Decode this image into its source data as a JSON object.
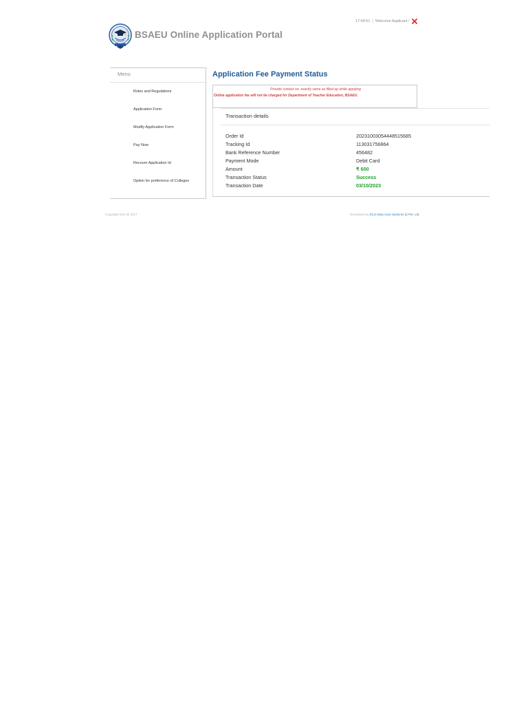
{
  "header": {
    "time": "17:49:51",
    "separator": "|",
    "welcome": "Welcome Applicant !",
    "title": "BSAEU Online Application Portal",
    "close_icon": "close-icon",
    "logo_icon": "university-seal-icon"
  },
  "sidebar": {
    "heading": "Menu",
    "items": [
      {
        "label": "Rules and Regulations"
      },
      {
        "label": "Application Form"
      },
      {
        "label": "Modify Application Form"
      },
      {
        "label": "Pay Now"
      },
      {
        "label": "Recover Application Id"
      },
      {
        "label": "Option for preference of Colleges"
      }
    ]
  },
  "main": {
    "title": "Application Fee Payment Status",
    "notice_1": "Provide contact no. exactly same as filled-up while applying",
    "notice_2": "Online application fee will not be charged for Department of Teacher Education, BSAEU.",
    "transaction_heading": "Transaction details",
    "transaction": [
      {
        "label": "Order Id",
        "value": "20231003054448515685"
      },
      {
        "label": "Tracking Id",
        "value": "113031756864"
      },
      {
        "label": "Bank Reference Number",
        "value": "456482"
      },
      {
        "label": "Payment Mode",
        "value": "Debit Card"
      },
      {
        "label": "Amount",
        "value": "₹ 600"
      },
      {
        "label": "Transaction Status",
        "value": "Success"
      },
      {
        "label": "Transaction Date",
        "value": "03/10/2023"
      }
    ]
  },
  "footer": {
    "copyright": "Copyright from @ 2017",
    "developed_by": "Developed by",
    "developer": "ECS Data Care Systems (I) Pvt. Ltd."
  },
  "colors": {
    "title_blue": "#1c5b96",
    "notice_red": "#d33a3a",
    "success_green": "#1e9e2a",
    "link_blue": "#2d7fc1"
  }
}
